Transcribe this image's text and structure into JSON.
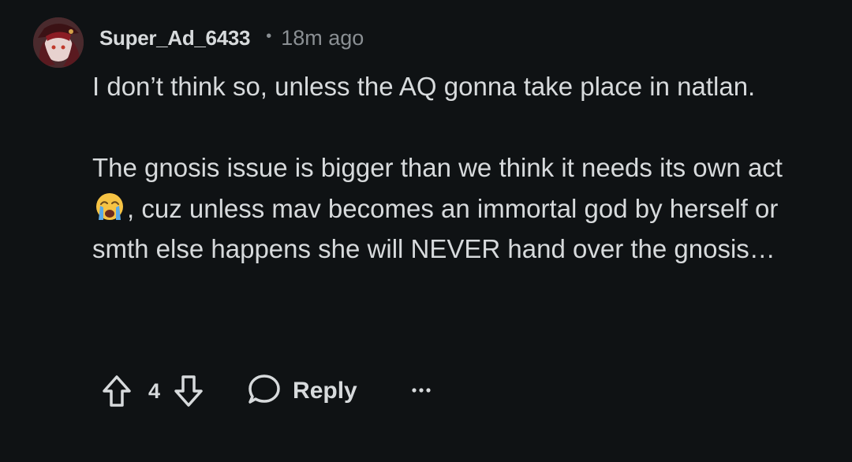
{
  "comment": {
    "author": "Super_Ad_6433",
    "separator": "•",
    "time": "18m ago",
    "paragraphs": [
      {
        "text": "I don’t think so, unless the AQ gonna take place in natlan."
      },
      {
        "before_emoji": "The gnosis issue is bigger than we think it needs its own act ",
        "emoji": "loudly-crying-face",
        "after_emoji": ", cuz unless mav becomes an immortal god by herself or smth else happens she will NEVER hand over the gnosis…"
      }
    ],
    "score": "4",
    "reply_label": "Reply"
  },
  "icons": {
    "upvote": "upvote-arrow-icon",
    "downvote": "downvote-arrow-icon",
    "reply": "speech-bubble-icon",
    "more": "ellipsis-icon"
  },
  "colors": {
    "background": "#0f1214",
    "text": "#d7dadc",
    "muted": "#8a8f93"
  }
}
